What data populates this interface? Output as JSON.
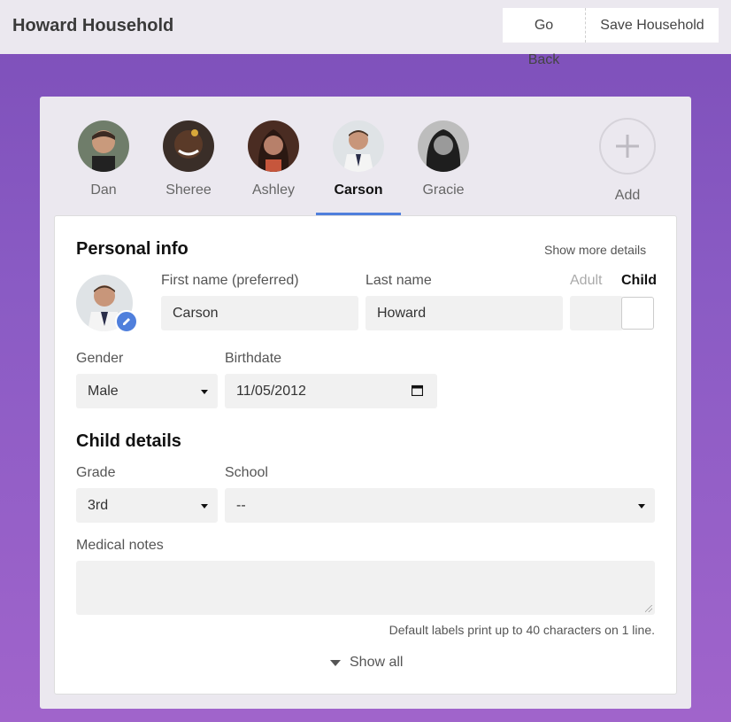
{
  "header": {
    "title": "Howard Household",
    "go_back_label": "Go Back",
    "save_label": "Save Household"
  },
  "members": [
    {
      "name": "Dan"
    },
    {
      "name": "Sheree"
    },
    {
      "name": "Ashley"
    },
    {
      "name": "Carson",
      "active": true
    },
    {
      "name": "Gracie"
    }
  ],
  "add_label": "Add",
  "personal": {
    "heading": "Personal info",
    "show_more": "Show more details",
    "first_name_label": "First name (preferred)",
    "first_name_value": "Carson",
    "last_name_label": "Last name",
    "last_name_value": "Howard",
    "adult_label": "Adult",
    "child_label": "Child",
    "gender_label": "Gender",
    "gender_value": "Male",
    "birthdate_label": "Birthdate",
    "birthdate_value": "11/05/2012"
  },
  "child_details": {
    "heading": "Child details",
    "grade_label": "Grade",
    "grade_value": "3rd",
    "school_label": "School",
    "school_value": "--",
    "medical_label": "Medical notes",
    "medical_value": "",
    "hint": "Default labels print up to 40 characters on 1 line."
  },
  "show_all": "Show all",
  "colors": {
    "accent": "#4f7fdc",
    "bg_gradient_top": "#7d4fb9",
    "bg_gradient_bottom": "#a064cb"
  }
}
